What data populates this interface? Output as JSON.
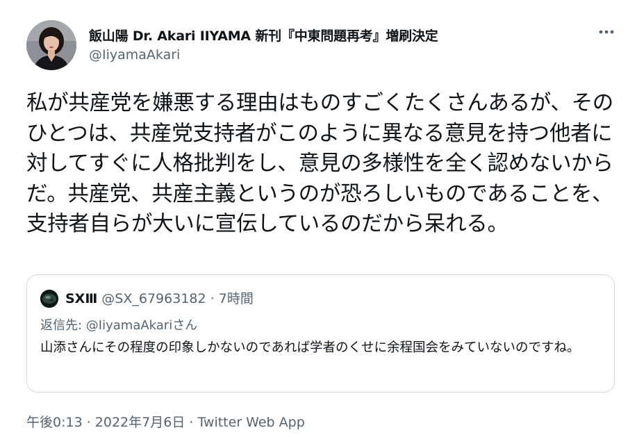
{
  "author": {
    "display_name": "飯山陽 Dr. Akari IIYAMA 新刊『中東問題再考』増刷決定",
    "handle": "@IiyamaAkari"
  },
  "tweet": {
    "text": "私が共産党を嫌悪する理由はものすごくたくさんあるが、そのひとつは、共産党支持者がこのように異なる意見を持つ他者に対してすぐに人格批判をし、意見の多様性を全く認めないからだ。共産党、共産主義というのが恐ろしいものであることを、支持者自らが大いに宣伝しているのだから呆れる。"
  },
  "quote": {
    "display_name": "SXⅢ",
    "handle": "@SX_67963182",
    "separator": "·",
    "time": "7時間",
    "reply_prefix": "返信先: ",
    "reply_mention": "@IiyamaAkari",
    "reply_suffix": "さん",
    "text": "山添さんにその程度の印象しかないのであれば学者のくせに余程国会をみていないのですね。"
  },
  "meta": {
    "time": "午後0:13",
    "sep1": " · ",
    "date": "2022年7月6日",
    "sep2": " · ",
    "source": "Twitter Web App"
  },
  "icons": {
    "more": "more-horizontal-icon",
    "avatar": "profile-photo",
    "quote_avatar": "profile-photo"
  }
}
